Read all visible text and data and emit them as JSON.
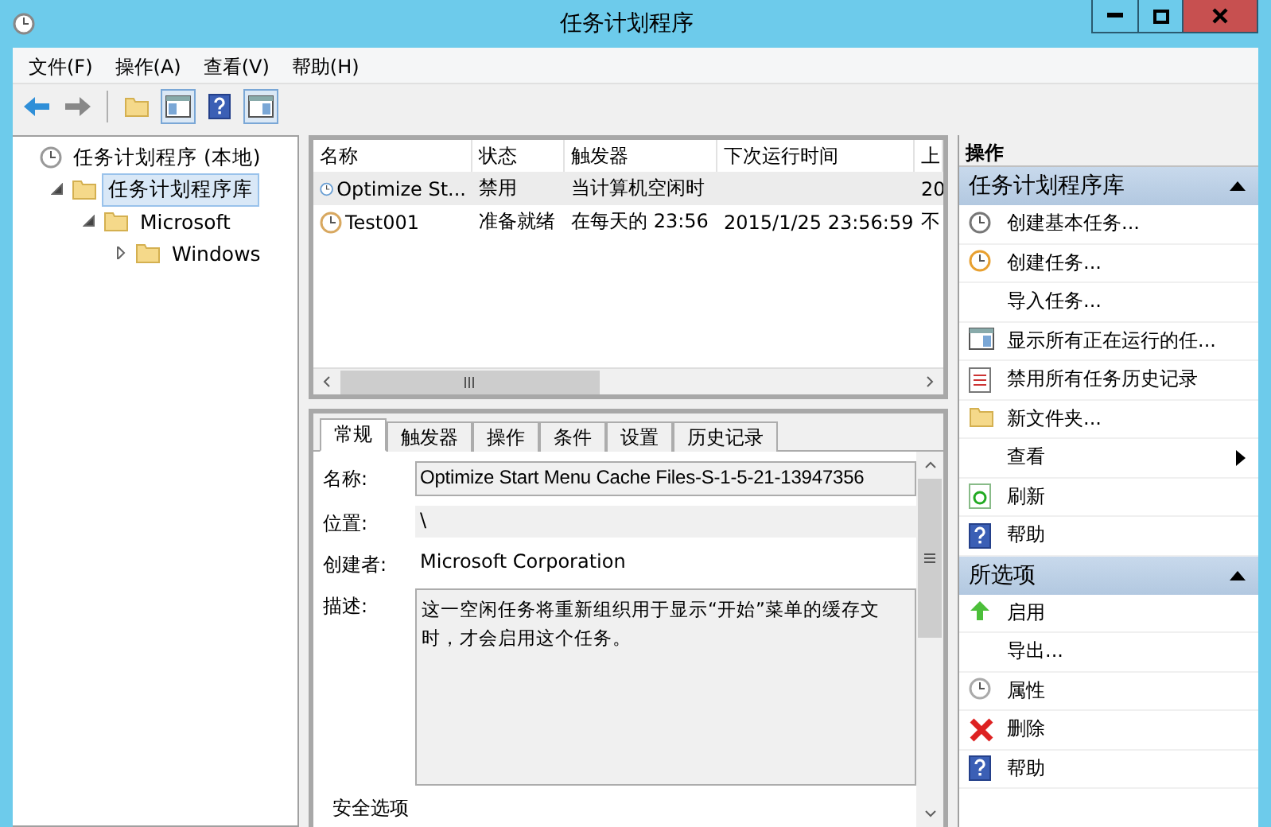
{
  "window": {
    "title": "任务计划程序"
  },
  "menu": [
    "文件(F)",
    "操作(A)",
    "查看(V)",
    "帮助(H)"
  ],
  "tree": [
    {
      "label": "任务计划程序 (本地)",
      "selected": false,
      "expanded": true,
      "children": [
        {
          "label": "任务计划程序库",
          "selected": true,
          "expanded": true,
          "children": [
            {
              "label": "Microsoft",
              "selected": false,
              "expanded": true,
              "children": [
                {
                  "label": "Windows",
                  "selected": false,
                  "expanded": false
                }
              ]
            }
          ]
        }
      ]
    }
  ],
  "task_list": {
    "columns": [
      "名称",
      "状态",
      "触发器",
      "下次运行时间",
      "上"
    ],
    "rows": [
      {
        "selected": true,
        "cells": [
          "Optimize St...",
          "禁用",
          "当计算机空闲时",
          "",
          "20"
        ]
      },
      {
        "selected": false,
        "cells": [
          "Test001",
          "准备就绪",
          "在每天的 23:56",
          "2015/1/25 23:56:59",
          "不"
        ]
      }
    ]
  },
  "detail_tabs": [
    {
      "label": "常规",
      "selected": true
    },
    {
      "label": "触发器",
      "selected": false
    },
    {
      "label": "操作",
      "selected": false
    },
    {
      "label": "条件",
      "selected": false
    },
    {
      "label": "设置",
      "selected": false
    },
    {
      "label": "历史记录",
      "selected": false
    }
  ],
  "general": {
    "name_label": "名称:",
    "name_value": "Optimize Start Menu Cache Files-S-1-5-21-13947356",
    "location_label": "位置:",
    "location_value": "\\",
    "author_label": "创建者:",
    "author_value": "Microsoft Corporation",
    "description_label": "描述:",
    "description_lines": [
      "这一空闲任务将重新组织用于显示“开始”菜单的缓存文",
      "时，才会启用这个任务。"
    ],
    "security_heading": "安全选项"
  },
  "actions": {
    "title": "操作",
    "sections": [
      {
        "title": "任务计划程序库",
        "expanded": true,
        "items": [
          {
            "label": "创建基本任务...",
            "submenu": false
          },
          {
            "label": "创建任务...",
            "submenu": false
          },
          {
            "label": "导入任务...",
            "submenu": false
          },
          {
            "label": "显示所有正在运行的任...",
            "submenu": false
          },
          {
            "label": "禁用所有任务历史记录",
            "submenu": false
          },
          {
            "label": "新文件夹...",
            "submenu": false
          },
          {
            "label": "查看",
            "submenu": true
          },
          {
            "label": "刷新",
            "submenu": false
          },
          {
            "label": "帮助",
            "submenu": false
          }
        ]
      },
      {
        "title": "所选项",
        "expanded": true,
        "items": [
          {
            "label": "启用",
            "submenu": false
          },
          {
            "label": "导出...",
            "submenu": false
          },
          {
            "label": "属性",
            "submenu": false
          },
          {
            "label": "删除",
            "submenu": false
          },
          {
            "label": "帮助",
            "submenu": false
          }
        ]
      }
    ]
  }
}
